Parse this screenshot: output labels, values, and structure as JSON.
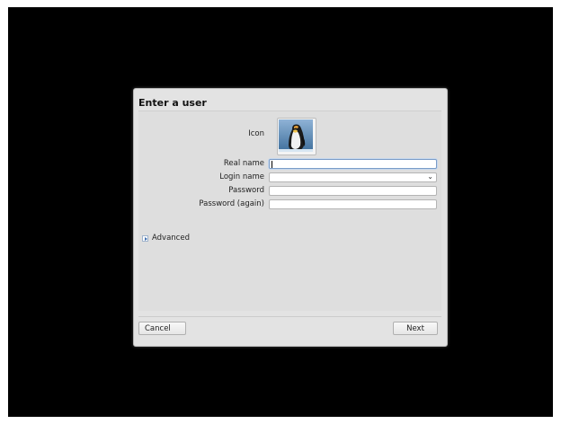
{
  "dialog": {
    "title": "Enter a user",
    "fields": {
      "icon_label": "Icon",
      "real_name_label": "Real name",
      "real_name_value": "",
      "login_name_label": "Login name",
      "login_name_value": "",
      "password_label": "Password",
      "password_value": "",
      "password_again_label": "Password (again)",
      "password_again_value": ""
    },
    "advanced_label": "Advanced",
    "buttons": {
      "cancel": "Cancel",
      "next": "Next"
    },
    "icon": "penguin-avatar-icon"
  }
}
